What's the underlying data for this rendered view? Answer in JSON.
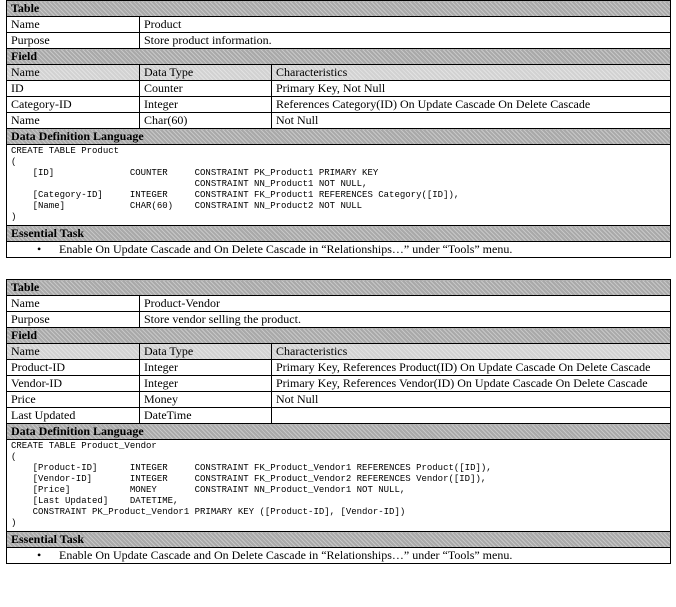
{
  "tables": [
    {
      "section_table": "Table",
      "name_label": "Name",
      "name_value": "Product",
      "purpose_label": "Purpose",
      "purpose_value": "Store product information.",
      "section_field": "Field",
      "field_headers": [
        "Name",
        "Data Type",
        "Characteristics"
      ],
      "fields": [
        {
          "name": "ID",
          "type": "Counter",
          "chars": "Primary Key, Not Null"
        },
        {
          "name": "Category-ID",
          "type": "Integer",
          "chars": "References Category(ID) On Update Cascade On Delete Cascade"
        },
        {
          "name": "Name",
          "type": "Char(60)",
          "chars": "Not Null"
        }
      ],
      "section_ddl": "Data Definition Language",
      "ddl": "CREATE TABLE Product\n(\n    [ID]              COUNTER     CONSTRAINT PK_Product1 PRIMARY KEY\n                                  CONSTRAINT NN_Product1 NOT NULL,\n    [Category-ID]     INTEGER     CONSTRAINT FK_Product1 REFERENCES Category([ID]),\n    [Name]            CHAR(60)    CONSTRAINT NN_Product2 NOT NULL\n)",
      "section_task": "Essential Task",
      "bullet": "•",
      "task": "Enable On Update Cascade and On Delete Cascade in “Relationships…” under “Tools” menu."
    },
    {
      "section_table": "Table",
      "name_label": "Name",
      "name_value": "Product-Vendor",
      "purpose_label": "Purpose",
      "purpose_value": "Store vendor selling the product.",
      "section_field": "Field",
      "field_headers": [
        "Name",
        "Data Type",
        "Characteristics"
      ],
      "fields": [
        {
          "name": "Product-ID",
          "type": "Integer",
          "chars": "Primary Key, References Product(ID) On Update Cascade On Delete Cascade"
        },
        {
          "name": "Vendor-ID",
          "type": "Integer",
          "chars": "Primary Key, References Vendor(ID) On Update Cascade On Delete Cascade"
        },
        {
          "name": "Price",
          "type": "Money",
          "chars": "Not Null"
        },
        {
          "name": "Last Updated",
          "type": "DateTime",
          "chars": ""
        }
      ],
      "section_ddl": "Data Definition Language",
      "ddl": "CREATE TABLE Product_Vendor\n(\n    [Product-ID]      INTEGER     CONSTRAINT FK_Product_Vendor1 REFERENCES Product([ID]),\n    [Vendor-ID]       INTEGER     CONSTRAINT FK_Product_Vendor2 REFERENCES Vendor([ID]),\n    [Price]           MONEY       CONSTRAINT NN_Product_Vendor1 NOT NULL,\n    [Last Updated]    DATETIME,\n    CONSTRAINT PK_Product_Vendor1 PRIMARY KEY ([Product-ID], [Vendor-ID])\n)",
      "section_task": "Essential Task",
      "bullet": "•",
      "task": "Enable On Update Cascade and On Delete Cascade in “Relationships…” under “Tools” menu."
    }
  ]
}
